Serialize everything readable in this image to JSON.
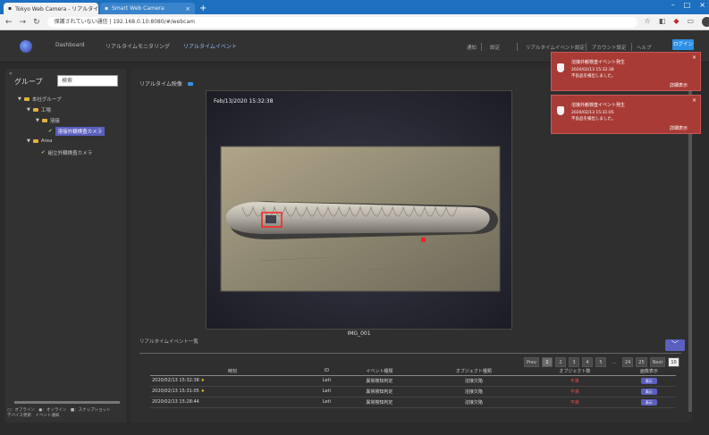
{
  "browser": {
    "tabs": [
      {
        "label": "Tokyo Web Camera - リアルタイム",
        "active": true
      },
      {
        "label": "Smart Web Camera",
        "active": false
      }
    ],
    "url": "保護されていない通信 | 192.168.0.10:8080/#/webcam"
  },
  "header": {
    "menu": [
      "Dashboard",
      "リアルタイムモニタリング",
      "リアルタイムイベント"
    ],
    "right_menu": [
      "通知",
      "設定",
      "リアルタイムイベント設定",
      "アカウント設定",
      "ヘルプ"
    ],
    "login_label": "ログイン"
  },
  "sidebar": {
    "title": "グループ",
    "search_placeholder": "検索",
    "tree": [
      {
        "label": "本社グループ",
        "depth": 0
      },
      {
        "label": "工場",
        "depth": 1
      },
      {
        "label": "溶接",
        "depth": 2
      },
      {
        "label": "溶接外観検査カメラ",
        "depth": 3,
        "selected": true
      },
      {
        "label": "Area",
        "depth": 1
      },
      {
        "label": "組立外観検査カメラ",
        "depth": 2
      }
    ],
    "legend": "○：オフライン　●：オンライン　■：スナップショット",
    "legend2": "デバイス更新　イベント通知"
  },
  "main": {
    "title": "リアルタイム映像",
    "timestamp": "Feb/13/2020 15:32:38",
    "caption": "IMG_001",
    "events_title": "リアルタイムイベント一覧",
    "pager": [
      "Prev",
      "1",
      "2",
      "3",
      "4",
      "5",
      "…",
      "24",
      "25",
      "Next",
      "10"
    ],
    "table": {
      "headers": [
        "時刻",
        "ID",
        "イベント種類",
        "オブジェクト種類",
        "オブジェクト数",
        "画像表示"
      ],
      "rows": [
        {
          "time": "2020/02/13 15:32:38",
          "id": "Leti",
          "type": "異常検知判定",
          "object": "溶接欠陥",
          "count": "不良",
          "action": "表示"
        },
        {
          "time": "2020/02/13 15:31:05",
          "id": "Leti",
          "type": "異常検知判定",
          "object": "溶接欠陥",
          "count": "不良",
          "action": "表示"
        },
        {
          "time": "2020/02/13 15:28:44",
          "id": "Leti",
          "type": "異常検知判定",
          "object": "溶接欠陥",
          "count": "不良",
          "action": "表示"
        }
      ]
    }
  },
  "toasts": [
    {
      "title": "溶接外観検査イベント発生",
      "line1": "2020/02/13 15:32:38",
      "line2": "不良品を検出しました。",
      "detail": "詳細表示"
    },
    {
      "title": "溶接外観検査イベント発生",
      "line1": "2020/02/13 15:31:05",
      "line2": "不良品を検出しました。",
      "detail": "詳細表示"
    }
  ],
  "colors": {
    "accent": "#5b5fbf",
    "alert": "#a93b36",
    "primary": "#2d8fe6"
  }
}
